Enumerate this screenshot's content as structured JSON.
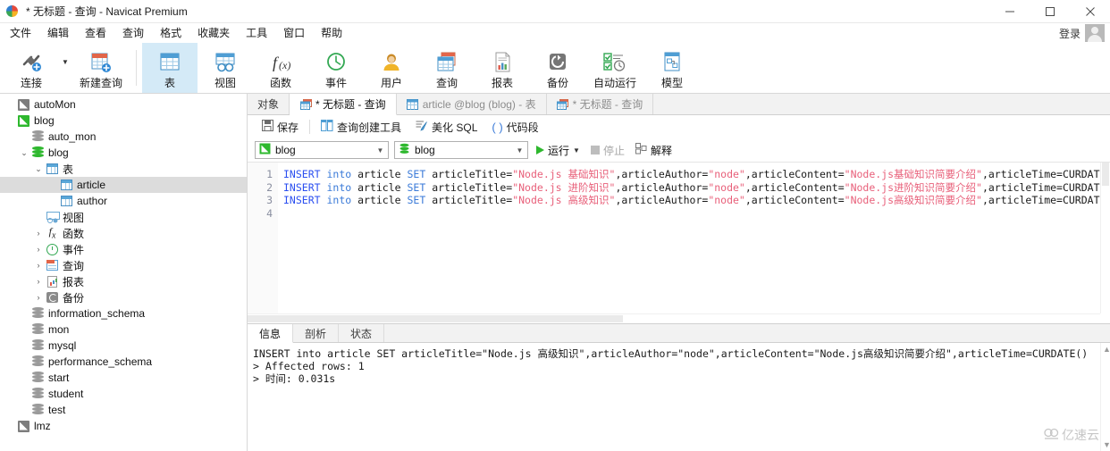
{
  "window": {
    "title": "* 无标题 - 查询 - Navicat Premium",
    "minimize": "−",
    "maximize": "□",
    "close": "✕"
  },
  "menubar": {
    "items": [
      "文件",
      "编辑",
      "查看",
      "查询",
      "格式",
      "收藏夹",
      "工具",
      "窗口",
      "帮助"
    ],
    "login_label": "登录"
  },
  "toolbar": {
    "items": [
      {
        "label": "连接",
        "icon": "connection-icon",
        "active": false,
        "caret": true
      },
      {
        "label": "新建查询",
        "icon": "new-query-icon",
        "active": false,
        "caret": false
      },
      {
        "label": "表",
        "icon": "table-icon",
        "active": true,
        "caret": false
      },
      {
        "label": "视图",
        "icon": "view-icon",
        "active": false,
        "caret": false
      },
      {
        "label": "函数",
        "icon": "function-icon",
        "active": false,
        "caret": false
      },
      {
        "label": "事件",
        "icon": "event-icon",
        "active": false,
        "caret": false
      },
      {
        "label": "用户",
        "icon": "user-icon",
        "active": false,
        "caret": false
      },
      {
        "label": "查询",
        "icon": "query-icon",
        "active": false,
        "caret": false
      },
      {
        "label": "报表",
        "icon": "report-icon",
        "active": false,
        "caret": false
      },
      {
        "label": "备份",
        "icon": "backup-icon",
        "active": false,
        "caret": false
      },
      {
        "label": "自动运行",
        "icon": "automation-icon",
        "active": false,
        "caret": false
      },
      {
        "label": "模型",
        "icon": "model-icon",
        "active": false,
        "caret": false
      }
    ]
  },
  "sidebar": {
    "items": [
      {
        "label": "autoMon",
        "indent": 0,
        "icon": "connection-grey-icon",
        "twisty": "",
        "selected": false
      },
      {
        "label": "blog",
        "indent": 0,
        "icon": "connection-green-icon",
        "twisty": "",
        "selected": false
      },
      {
        "label": "auto_mon",
        "indent": 1,
        "icon": "database-grey-icon",
        "twisty": "",
        "selected": false
      },
      {
        "label": "blog",
        "indent": 1,
        "icon": "database-green-icon",
        "twisty": "v",
        "selected": false
      },
      {
        "label": "表",
        "indent": 2,
        "icon": "table-icon",
        "twisty": "v",
        "selected": false
      },
      {
        "label": "article",
        "indent": 3,
        "icon": "table-icon",
        "twisty": "",
        "selected": true
      },
      {
        "label": "author",
        "indent": 3,
        "icon": "table-icon",
        "twisty": "",
        "selected": false
      },
      {
        "label": "视图",
        "indent": 2,
        "icon": "view-icon",
        "twisty": "",
        "selected": false
      },
      {
        "label": "函数",
        "indent": 2,
        "icon": "function-icon",
        "twisty": ">",
        "selected": false
      },
      {
        "label": "事件",
        "indent": 2,
        "icon": "event-icon",
        "twisty": ">",
        "selected": false
      },
      {
        "label": "查询",
        "indent": 2,
        "icon": "query-icon",
        "twisty": ">",
        "selected": false
      },
      {
        "label": "报表",
        "indent": 2,
        "icon": "report-icon",
        "twisty": ">",
        "selected": false
      },
      {
        "label": "备份",
        "indent": 2,
        "icon": "backup-icon",
        "twisty": ">",
        "selected": false
      },
      {
        "label": "information_schema",
        "indent": 1,
        "icon": "database-grey-icon",
        "twisty": "",
        "selected": false
      },
      {
        "label": "mon",
        "indent": 1,
        "icon": "database-grey-icon",
        "twisty": "",
        "selected": false
      },
      {
        "label": "mysql",
        "indent": 1,
        "icon": "database-grey-icon",
        "twisty": "",
        "selected": false
      },
      {
        "label": "performance_schema",
        "indent": 1,
        "icon": "database-grey-icon",
        "twisty": "",
        "selected": false
      },
      {
        "label": "start",
        "indent": 1,
        "icon": "database-grey-icon",
        "twisty": "",
        "selected": false
      },
      {
        "label": "student",
        "indent": 1,
        "icon": "database-grey-icon",
        "twisty": "",
        "selected": false
      },
      {
        "label": "test",
        "indent": 1,
        "icon": "database-grey-icon",
        "twisty": "",
        "selected": false
      },
      {
        "label": "lmz",
        "indent": 0,
        "icon": "connection-grey-icon",
        "twisty": "",
        "selected": false
      }
    ]
  },
  "tabs": [
    {
      "label": "对象",
      "icon": "none",
      "state": "normal"
    },
    {
      "label": "* 无标题 - 查询",
      "icon": "query-icon",
      "state": "active"
    },
    {
      "label": "article @blog (blog) - 表",
      "icon": "table-icon",
      "state": "dim"
    },
    {
      "label": "* 无标题 - 查询",
      "icon": "query-icon",
      "state": "dim"
    }
  ],
  "query_toolbar": {
    "save": "保存",
    "query_builder": "查询创建工具",
    "beautify_sql": "美化 SQL",
    "snippet": "代码段"
  },
  "query_bar": {
    "connection_value": "blog",
    "database_value": "blog",
    "run_label": "运行",
    "stop_label": "停止",
    "explain_label": "解释"
  },
  "editor": {
    "line_numbers": [
      "1",
      "2",
      "3",
      "4"
    ],
    "lines": [
      [
        {
          "t": "INSERT ",
          "c": "kw"
        },
        {
          "t": "into ",
          "c": "kw2"
        },
        {
          "t": "article ",
          "c": ""
        },
        {
          "t": "SET ",
          "c": "kw2"
        },
        {
          "t": "articleTitle=",
          "c": ""
        },
        {
          "t": "\"Node.js 基础知识\"",
          "c": "str"
        },
        {
          "t": ",articleAuthor=",
          "c": ""
        },
        {
          "t": "\"node\"",
          "c": "str"
        },
        {
          "t": ",articleContent=",
          "c": ""
        },
        {
          "t": "\"Node.js基础知识简要介绍\"",
          "c": "str"
        },
        {
          "t": ",articleTime=CURDATE();",
          "c": ""
        }
      ],
      [
        {
          "t": "INSERT ",
          "c": "kw"
        },
        {
          "t": "into ",
          "c": "kw2"
        },
        {
          "t": "article ",
          "c": ""
        },
        {
          "t": "SET ",
          "c": "kw2"
        },
        {
          "t": "articleTitle=",
          "c": ""
        },
        {
          "t": "\"Node.js 进阶知识\"",
          "c": "str"
        },
        {
          "t": ",articleAuthor=",
          "c": ""
        },
        {
          "t": "\"node\"",
          "c": "str"
        },
        {
          "t": ",articleContent=",
          "c": ""
        },
        {
          "t": "\"Node.js进阶知识简要介绍\"",
          "c": "str"
        },
        {
          "t": ",articleTime=CURDATE();",
          "c": ""
        }
      ],
      [
        {
          "t": "INSERT ",
          "c": "kw"
        },
        {
          "t": "into ",
          "c": "kw2"
        },
        {
          "t": "article ",
          "c": ""
        },
        {
          "t": "SET ",
          "c": "kw2"
        },
        {
          "t": "articleTitle=",
          "c": ""
        },
        {
          "t": "\"Node.js 高级知识\"",
          "c": "str"
        },
        {
          "t": ",articleAuthor=",
          "c": ""
        },
        {
          "t": "\"node\"",
          "c": "str"
        },
        {
          "t": ",articleContent=",
          "c": ""
        },
        {
          "t": "\"Node.js高级知识简要介绍\"",
          "c": "str"
        },
        {
          "t": ",articleTime=CURDATE();",
          "c": ""
        }
      ],
      []
    ]
  },
  "result_panel": {
    "tabs": [
      {
        "label": "信息",
        "active": true
      },
      {
        "label": "剖析",
        "active": false
      },
      {
        "label": "状态",
        "active": false
      }
    ],
    "log": "INSERT into article SET articleTitle=\"Node.js 高级知识\",articleAuthor=\"node\",articleContent=\"Node.js高级知识简要介绍\",articleTime=CURDATE()\n> Affected rows: 1\n> 时间: 0.031s"
  },
  "watermark": {
    "text": "亿速云"
  }
}
